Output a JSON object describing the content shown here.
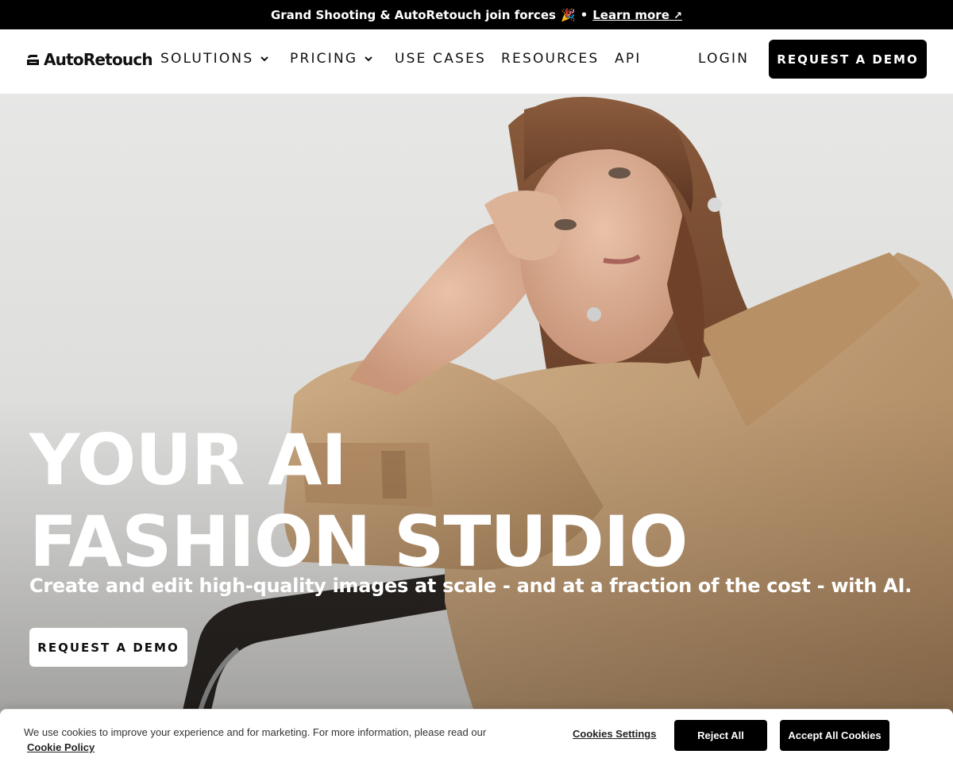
{
  "announcement": {
    "text": "Grand Shooting & AutoRetouch join forces",
    "emoji": "🎉",
    "separator": "•",
    "link_label": "Learn more",
    "link_arrow": "↗"
  },
  "nav": {
    "logo_text": "AutoRetouch",
    "items": [
      {
        "label": "SOLUTIONS",
        "has_dropdown": true
      },
      {
        "label": "PRICING",
        "has_dropdown": true
      },
      {
        "label": "USE CASES",
        "has_dropdown": false
      },
      {
        "label": "RESOURCES",
        "has_dropdown": false
      },
      {
        "label": "API",
        "has_dropdown": false
      }
    ],
    "login_label": "LOGIN",
    "cta_label": "REQUEST A DEMO"
  },
  "hero": {
    "headline_line1": "YOUR AI",
    "headline_line2": "FASHION STUDIO",
    "subline": "Create and edit high-quality images at scale - and at a fraction of the cost - with AI.",
    "cta_label": "REQUEST A DEMO"
  },
  "cookie_banner": {
    "text": "We use cookies to improve your experience and for marketing. For more information, please read our",
    "policy_link": "Cookie Policy",
    "settings_label": "Cookies Settings",
    "reject_label": "Reject All",
    "accept_label": "Accept All Cookies"
  },
  "colors": {
    "topbar": "#000000",
    "primary_button": "#000000",
    "hero_text": "#ffffff",
    "coat": "#c4a07a"
  }
}
